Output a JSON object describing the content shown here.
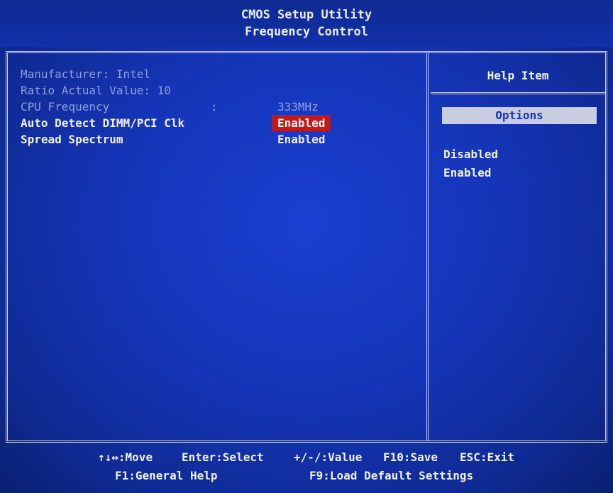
{
  "header": {
    "title": "CMOS Setup Utility",
    "subtitle": "Frequency Control"
  },
  "menu": {
    "items": [
      {
        "label": "Manufacturer: Intel",
        "colon": "",
        "value": ""
      },
      {
        "label": "Ratio Actual Value: 10",
        "colon": "",
        "value": ""
      },
      {
        "label": "CPU Frequency",
        "colon": ":",
        "value": "333MHz"
      },
      {
        "label": "Auto Detect DIMM/PCI Clk",
        "colon": "",
        "value": "Enabled"
      },
      {
        "label": "Spread Spectrum",
        "colon": "",
        "value": "Enabled"
      }
    ]
  },
  "help": {
    "title": "Help Item",
    "options_header": "Options",
    "options": [
      "Disabled",
      "Enabled"
    ]
  },
  "footer": {
    "line1": [
      ":Move",
      "Enter:Select",
      "+/-/:Value",
      "F10:Save",
      "ESC:Exit"
    ],
    "arrows": "↑↓↔",
    "line2": [
      "F1:General Help",
      "F9:Load Default Settings"
    ]
  },
  "colors": {
    "background": "#1535b8",
    "selection": "#c21a1a",
    "text": "#f2f2f2",
    "disabled_text": "#8ea0dc"
  }
}
